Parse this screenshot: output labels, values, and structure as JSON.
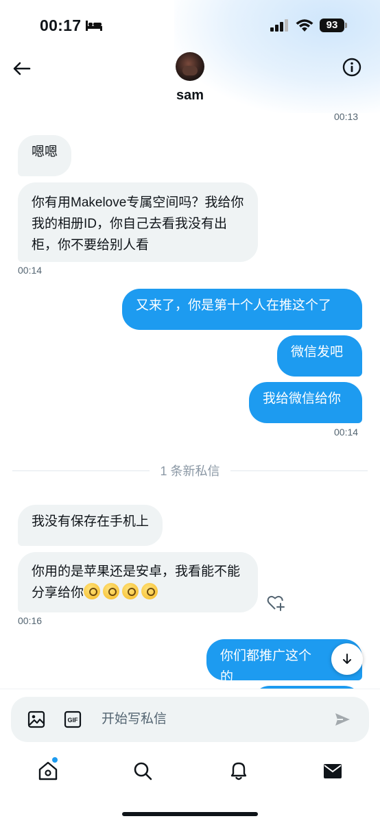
{
  "status": {
    "time": "00:17",
    "battery": "93"
  },
  "header": {
    "contact_name": "sam"
  },
  "messages": [
    {
      "id": "ts1",
      "text": "00:13"
    },
    {
      "id": "m1",
      "text": "嗯嗯"
    },
    {
      "id": "m2",
      "text": "你有用Makelove专属空间吗？我给你我的相册ID，你自己去看我没有出柜，你不要给别人看"
    },
    {
      "id": "ts2",
      "text": "00:14"
    },
    {
      "id": "m3",
      "text": "又来了，你是第十个人在推这个了"
    },
    {
      "id": "m4",
      "text": "微信发吧"
    },
    {
      "id": "m5",
      "text": "我给微信给你"
    },
    {
      "id": "ts3",
      "text": "00:14"
    },
    {
      "id": "m6",
      "text": "我没有保存在手机上"
    },
    {
      "id": "m7",
      "text": "你用的是苹果还是安卓，我看能不能分享给你"
    },
    {
      "id": "ts4",
      "text": "00:16"
    },
    {
      "id": "m8",
      "text": "你们都推广这个的"
    }
  ],
  "divider": "1 条新私信",
  "composer": {
    "placeholder": "开始写私信"
  },
  "icons": {
    "back": "arrow-left-icon",
    "info": "info-icon",
    "bed": "bed-icon",
    "signal": "signal-icon",
    "wifi": "wifi-icon",
    "image": "image-icon",
    "gif": "gif-icon",
    "send": "send-icon",
    "react": "heart-plus-icon",
    "scroll": "arrow-down-icon",
    "home": "home-icon",
    "search": "search-icon",
    "notifications": "bell-icon",
    "messages": "mail-icon"
  },
  "colors": {
    "accent": "#1d9bf0",
    "incoming_bubble": "#eff3f4",
    "text": "#0f1419",
    "muted": "#536471"
  }
}
